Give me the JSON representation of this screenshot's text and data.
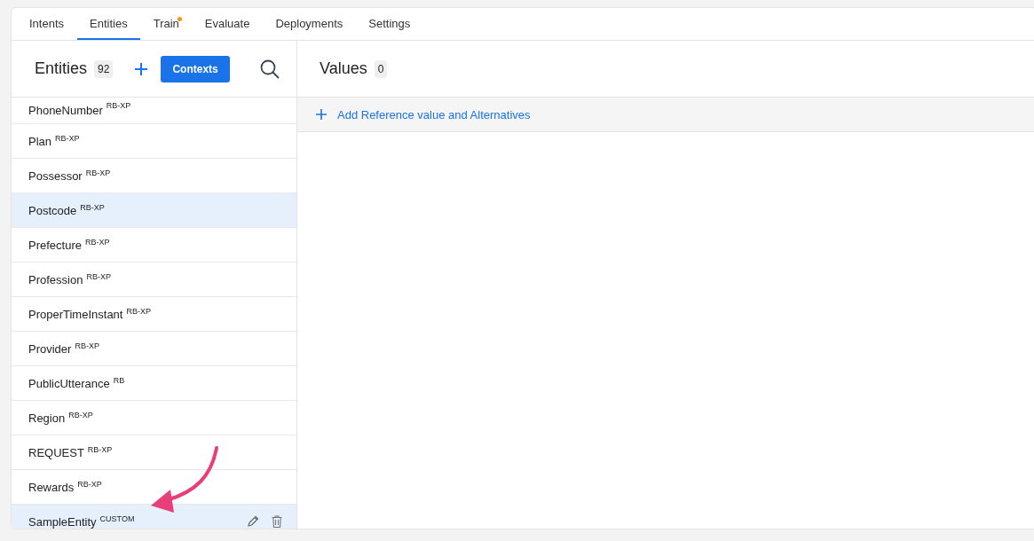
{
  "tabs": [
    {
      "label": "Intents",
      "selected": false,
      "dot": false
    },
    {
      "label": "Entities",
      "selected": true,
      "dot": false
    },
    {
      "label": "Train",
      "selected": false,
      "dot": true
    },
    {
      "label": "Evaluate",
      "selected": false,
      "dot": false
    },
    {
      "label": "Deployments",
      "selected": false,
      "dot": false
    },
    {
      "label": "Settings",
      "selected": false,
      "dot": false
    }
  ],
  "entities_panel": {
    "title": "Entities",
    "count": "92",
    "contexts_button": "Contexts",
    "items": [
      {
        "name": "PhoneNumber",
        "tag": "RB-XP",
        "selected": false,
        "hovered": false
      },
      {
        "name": "Plan",
        "tag": "RB-XP",
        "selected": false,
        "hovered": false
      },
      {
        "name": "Possessor",
        "tag": "RB-XP",
        "selected": false,
        "hovered": false
      },
      {
        "name": "Postcode",
        "tag": "RB-XP",
        "selected": true,
        "hovered": false
      },
      {
        "name": "Prefecture",
        "tag": "RB-XP",
        "selected": false,
        "hovered": false
      },
      {
        "name": "Profession",
        "tag": "RB-XP",
        "selected": false,
        "hovered": false
      },
      {
        "name": "ProperTimeInstant",
        "tag": "RB-XP",
        "selected": false,
        "hovered": false
      },
      {
        "name": "Provider",
        "tag": "RB-XP",
        "selected": false,
        "hovered": false
      },
      {
        "name": "PublicUtterance",
        "tag": "RB",
        "selected": false,
        "hovered": false
      },
      {
        "name": "Region",
        "tag": "RB-XP",
        "selected": false,
        "hovered": false
      },
      {
        "name": "REQUEST",
        "tag": "RB-XP",
        "selected": false,
        "hovered": false
      },
      {
        "name": "Rewards",
        "tag": "RB-XP",
        "selected": false,
        "hovered": false
      },
      {
        "name": "SampleEntity",
        "tag": "CUSTOM",
        "selected": true,
        "hovered": true
      }
    ]
  },
  "values_panel": {
    "title": "Values",
    "count": "0",
    "add_link": "Add Reference value and Alternatives"
  }
}
